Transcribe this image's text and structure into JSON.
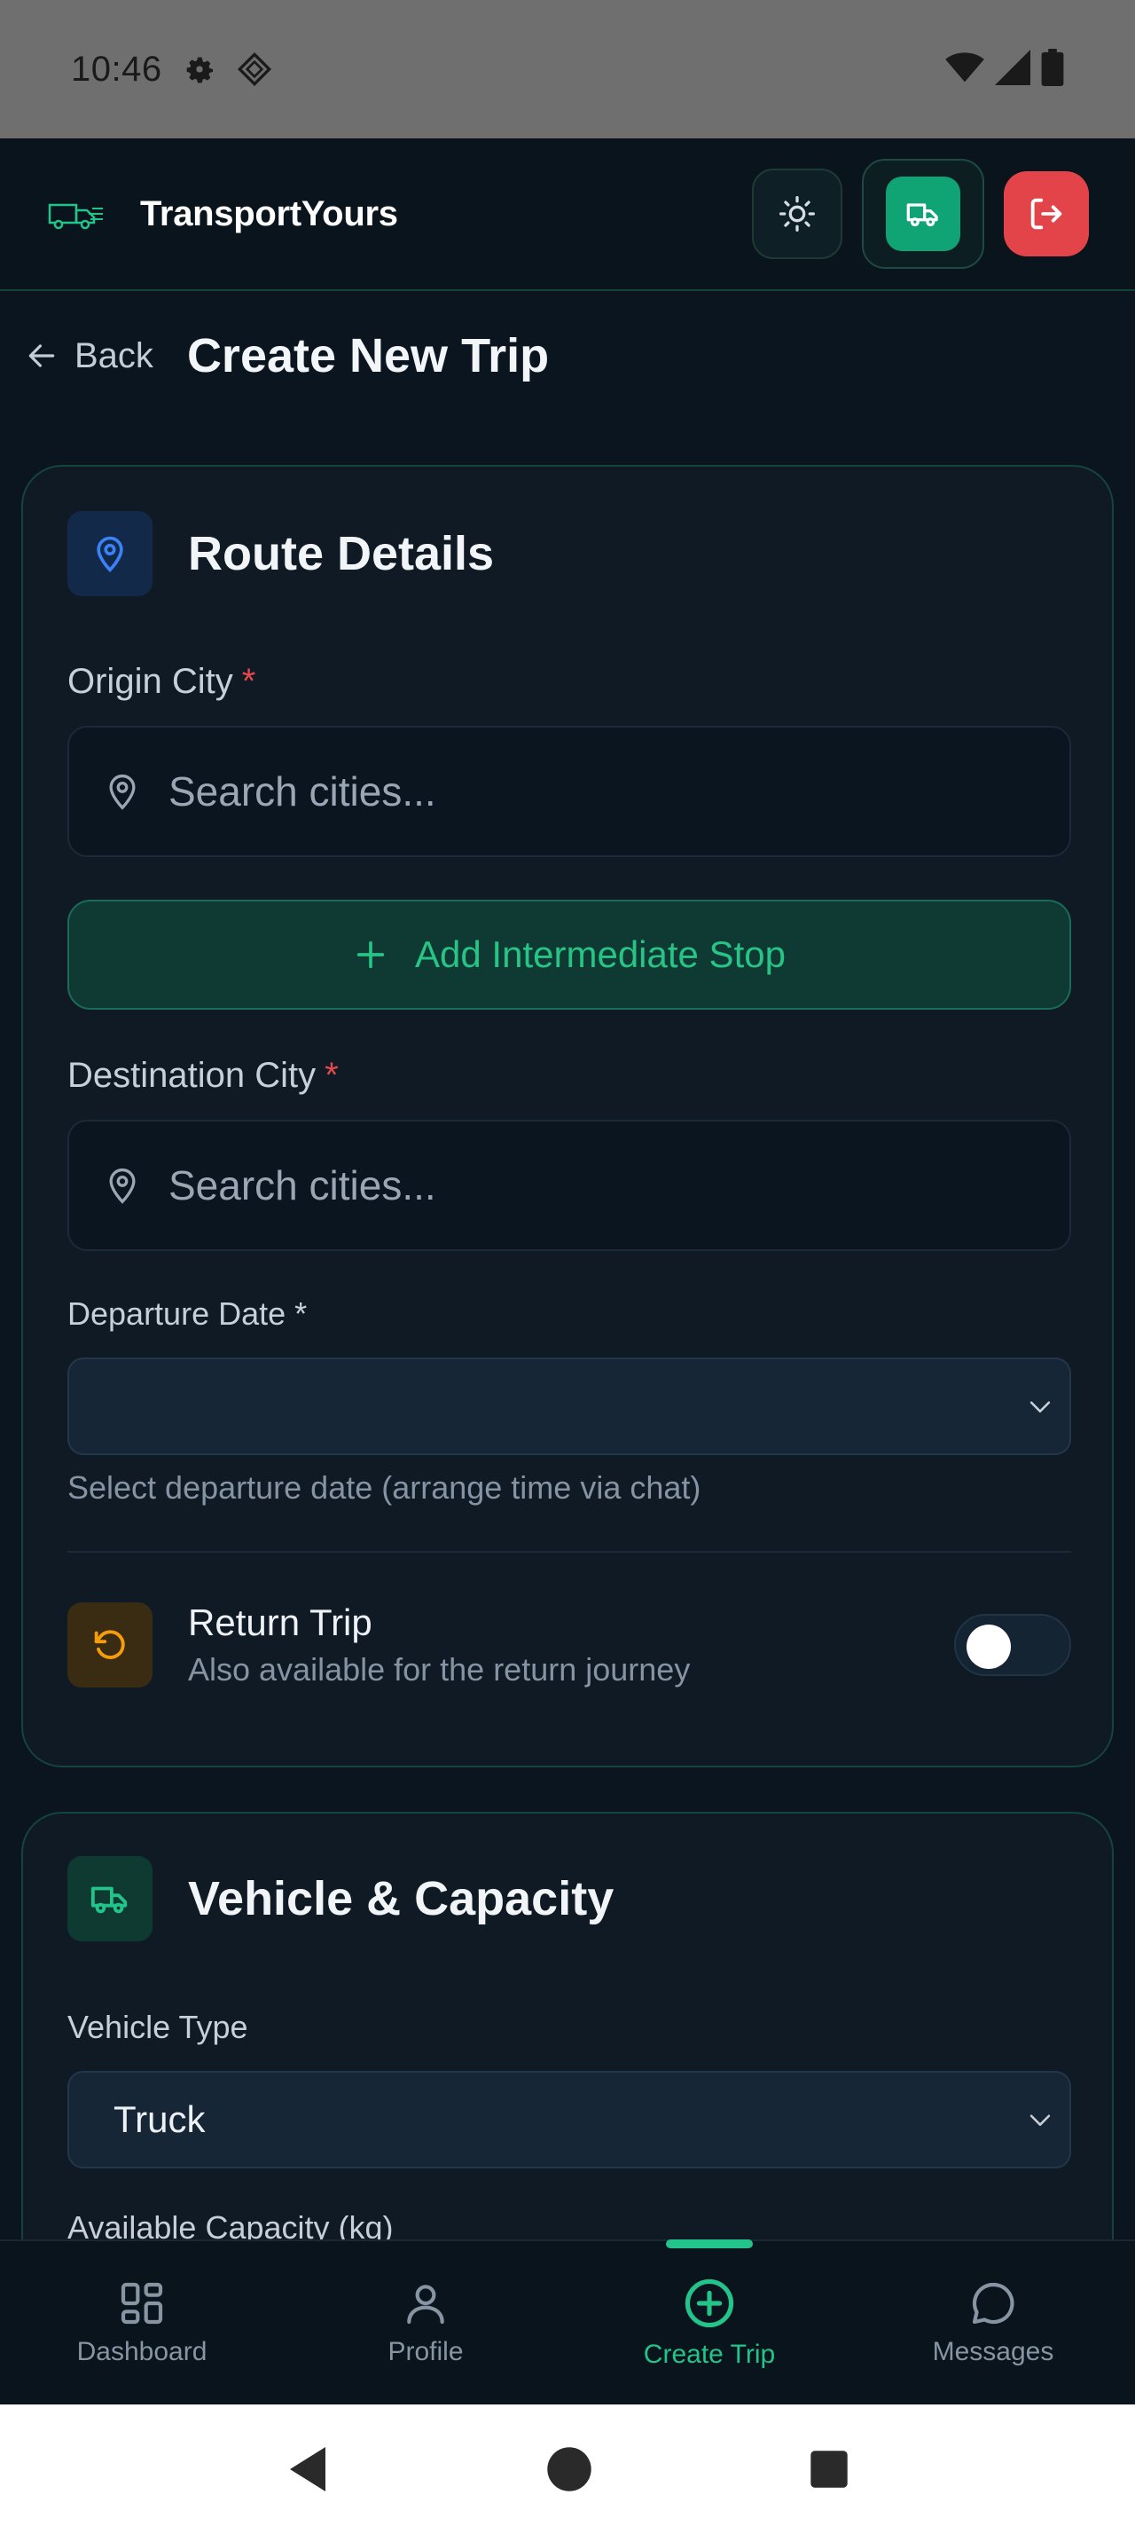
{
  "status_bar": {
    "time": "10:46"
  },
  "header": {
    "app_name": "TransportYours"
  },
  "page": {
    "back_label": "Back",
    "title": "Create New Trip"
  },
  "route_card": {
    "title": "Route Details",
    "origin_label": "Origin City",
    "origin_placeholder": "Search cities...",
    "add_stop_label": "Add Intermediate Stop",
    "destination_label": "Destination City",
    "destination_placeholder": "Search cities...",
    "required_mark": "*",
    "departure_label": "Departure Date *",
    "departure_value": "",
    "departure_hint": "Select departure date (arrange time via chat)",
    "return_title": "Return Trip",
    "return_subtitle": "Also available for the return journey",
    "return_enabled": false
  },
  "vehicle_card": {
    "title": "Vehicle & Capacity",
    "vehicle_type_label": "Vehicle Type",
    "vehicle_type_value": "Truck",
    "capacity_label": "Available Capacity (kg)"
  },
  "bottom_nav": {
    "items": [
      {
        "label": "Dashboard",
        "icon": "grid-icon"
      },
      {
        "label": "Profile",
        "icon": "user-icon"
      },
      {
        "label": "Create Trip",
        "icon": "plus-circle-icon",
        "active": true
      },
      {
        "label": "Messages",
        "icon": "chat-bubble-icon"
      }
    ]
  },
  "colors": {
    "accent": "#22c48a",
    "danger": "#e34449",
    "background": "#0b1520",
    "card": "#0f1a25"
  }
}
